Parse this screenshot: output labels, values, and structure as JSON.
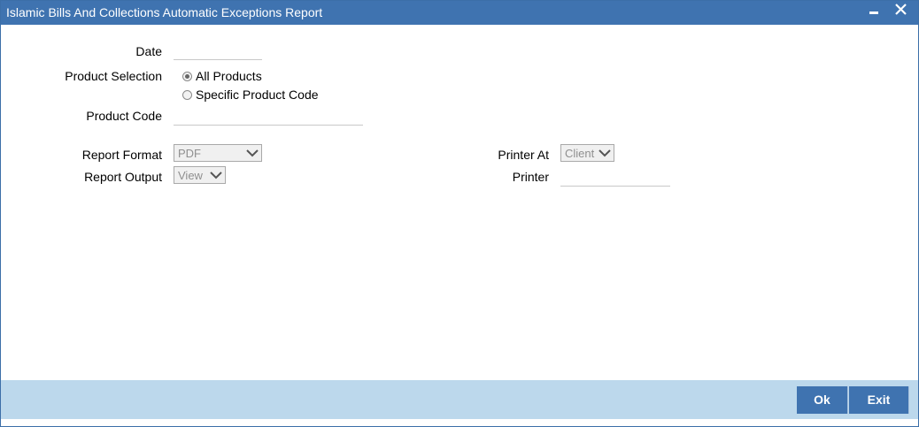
{
  "window": {
    "title": "Islamic Bills And Collections Automatic Exceptions Report",
    "minimize_icon": "minimize-icon",
    "close_icon": "close-icon"
  },
  "form": {
    "date_label": "Date",
    "date_value": "",
    "product_selection_label": "Product Selection",
    "product_selection_options": [
      "All Products",
      "Specific Product Code"
    ],
    "product_selection_selected": "All Products",
    "product_code_label": "Product Code",
    "product_code_value": "",
    "report_format_label": "Report Format",
    "report_format_value": "PDF",
    "report_output_label": "Report Output",
    "report_output_value": "View",
    "printer_at_label": "Printer At",
    "printer_at_value": "Client",
    "printer_label": "Printer",
    "printer_value": ""
  },
  "footer": {
    "ok_label": "Ok",
    "exit_label": "Exit"
  },
  "colors": {
    "title_bar": "#3f73b0",
    "footer_bar": "#bcd8ec",
    "button": "#3f73b0"
  }
}
